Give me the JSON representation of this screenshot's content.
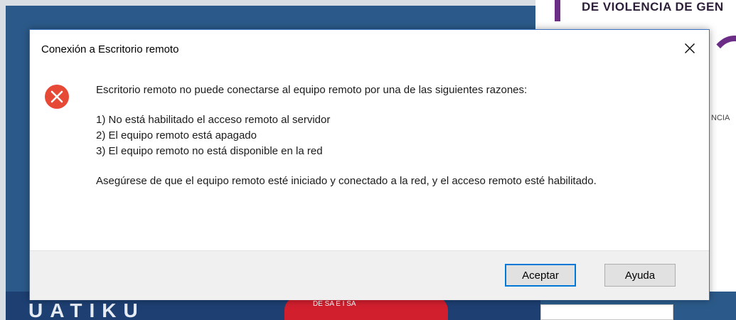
{
  "background": {
    "poster_title": "DE VIOLENCIA DE GEN",
    "poster_small_text": "NCIA",
    "bottom_glyphs": "UATIKU",
    "emblem_text": "DE SA      E I SA"
  },
  "dialog": {
    "title": "Conexión a Escritorio remoto",
    "close_icon": "close-icon",
    "status_icon": "error-icon",
    "colors": {
      "error": "#e64a36",
      "accent": "#0078d7"
    },
    "message": {
      "intro": "Escritorio remoto no puede conectarse al equipo remoto por una de las siguientes razones:",
      "reasons": [
        "1) No está habilitado el acceso remoto al servidor",
        "2) El equipo remoto está apagado",
        "3) El equipo remoto no está disponible en la red"
      ],
      "advice": "Asegúrese de que el equipo remoto esté iniciado y conectado a la red, y el acceso remoto esté habilitado."
    },
    "buttons": {
      "accept_label": "Aceptar",
      "help_label": "Ayuda"
    }
  }
}
